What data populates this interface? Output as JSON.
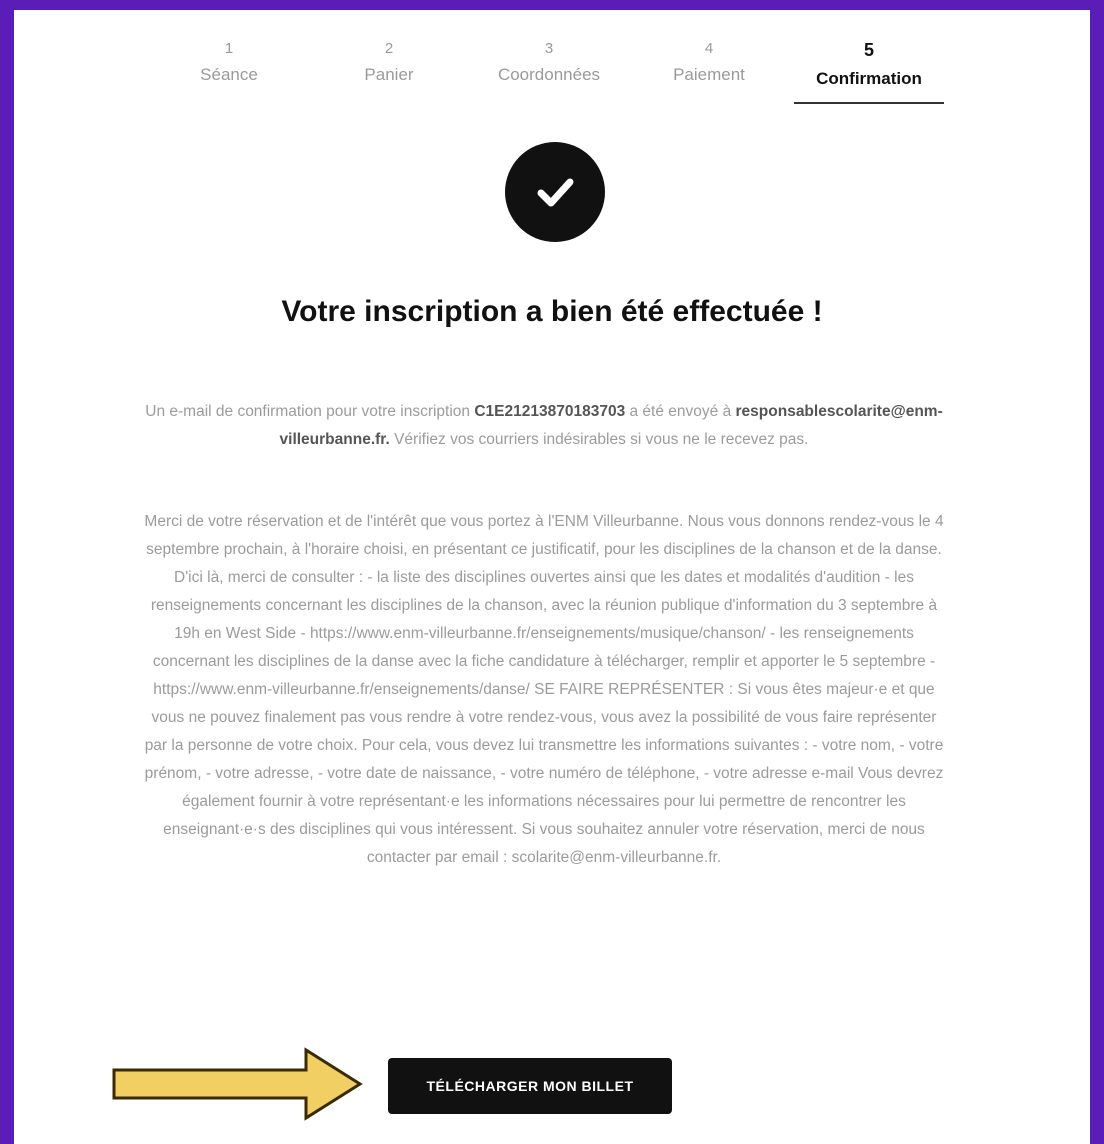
{
  "stepper": {
    "steps": [
      {
        "num": "1",
        "label": "Séance"
      },
      {
        "num": "2",
        "label": "Panier"
      },
      {
        "num": "3",
        "label": "Coordonnées"
      },
      {
        "num": "4",
        "label": "Paiement"
      },
      {
        "num": "5",
        "label": "Confirmation"
      }
    ],
    "active_step": 5
  },
  "confirmation": {
    "icon": "check-circle-icon",
    "title": "Votre inscription a bien été effectuée !",
    "email_msg": {
      "prefix": "Un e-mail de confirmation pour votre inscription ",
      "code": "C1E21213870183703",
      "middle": " a été envoyé à ",
      "email": "responsablescolarite@enm-villeurbanne.fr.",
      "suffix": " Vérifiez vos courriers indésirables si vous ne le recevez pas."
    },
    "thanks_msg": "Merci de votre réservation et de l'intérêt que vous portez à l'ENM Villeurbanne. Nous vous donnons rendez-vous le 4 septembre prochain, à l'horaire choisi, en présentant ce justificatif, pour les disciplines de la chanson et de la danse. D'ici là, merci de consulter : - la liste des disciplines ouvertes ainsi que les dates et modalités d'audition - les renseignements concernant les disciplines de la chanson, avec la réunion publique d'information du 3 septembre à 19h en West Side - https://www.enm-villeurbanne.fr/enseignements/musique/chanson/ - les renseignements concernant les disciplines de la danse avec la fiche candidature à télécharger, remplir et apporter le 5 septembre - https://www.enm-villeurbanne.fr/enseignements/danse/ SE FAIRE REPRÉSENTER : Si vous êtes majeur·e et que vous ne pouvez finalement pas vous rendre à votre rendez-vous, vous avez la possibilité de vous faire représenter par la personne de votre choix. Pour cela, vous devez lui transmettre les informations suivantes : - votre nom, - votre prénom, - votre adresse, - votre date de naissance, - votre numéro de téléphone, - votre adresse e-mail Vous devrez également fournir à votre représentant·e les informations nécessaires pour lui permettre de rencontrer les enseignant·e·s des disciplines qui vous intéressent. Si vous souhaitez annuler votre réservation, merci de nous contacter par email : scolarite@enm-villeurbanne.fr."
  },
  "download_button": {
    "label": "TÉLÉCHARGER MON BILLET"
  },
  "annotation": {
    "icon": "arrow-right-icon",
    "color": "#f2cf63",
    "outline": "#3a2a00"
  },
  "colors": {
    "frame": "#5b1db8",
    "panel": "#ffffff",
    "button": "#111111"
  }
}
